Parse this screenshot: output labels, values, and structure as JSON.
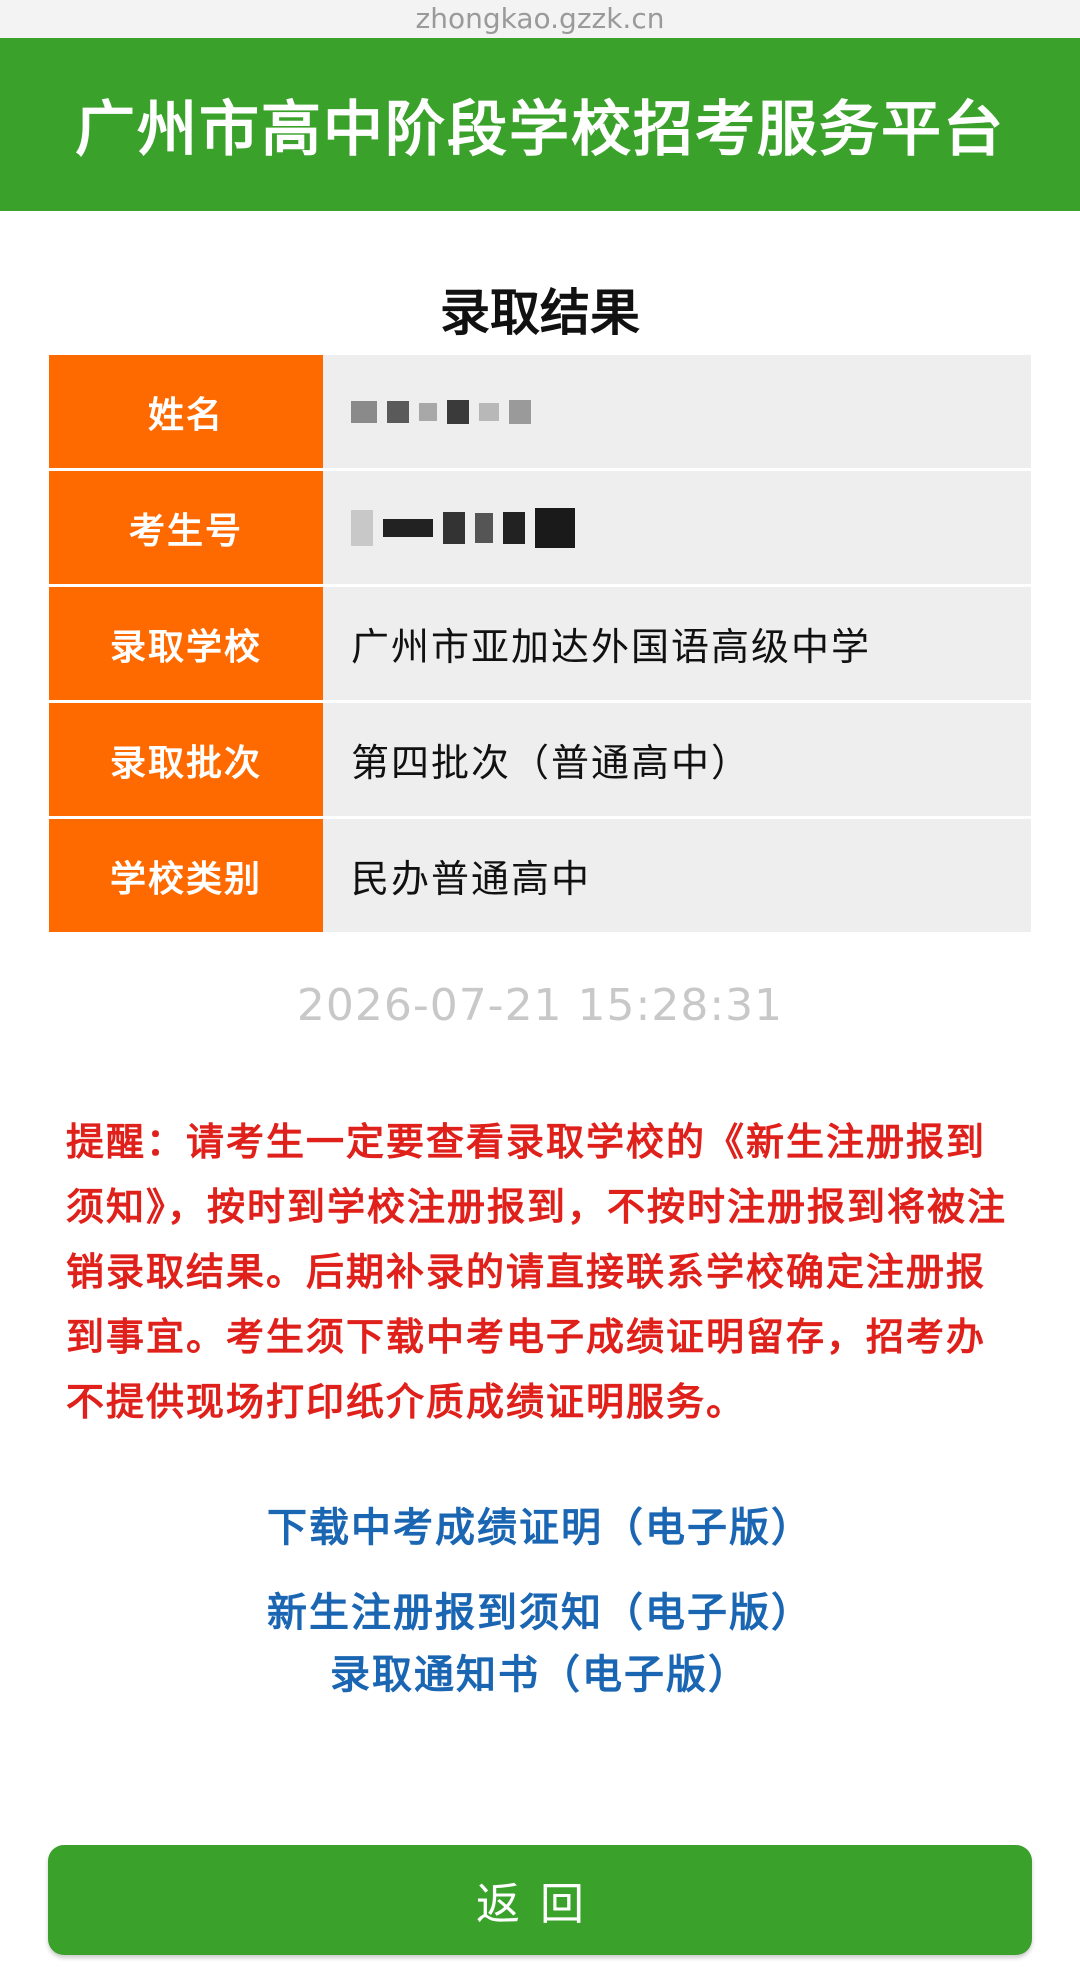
{
  "browser": {
    "url": "zhongkao.gzzk.cn"
  },
  "header": {
    "title": "广州市高中阶段学校招考服务平台"
  },
  "page": {
    "title": "录取结果"
  },
  "info_rows": [
    {
      "label": "姓名",
      "value": ""
    },
    {
      "label": "考生号",
      "value": ""
    },
    {
      "label": "录取学校",
      "value": "广州市亚加达外国语高级中学"
    },
    {
      "label": "录取批次",
      "value": "第四批次（普通高中）"
    },
    {
      "label": "学校类别",
      "value": "民办普通高中"
    }
  ],
  "timestamp": "2026-07-21 15:28:31",
  "reminder": "提醒：请考生一定要查看录取学校的《新生注册报到须知》，按时到学校注册报到，不按时注册报到将被注销录取结果。后期补录的请直接联系学校确定注册报到事宜。考生须下载中考电子成绩证明留存，招考办不提供现场打印纸介质成绩证明服务。",
  "links": [
    "下载中考成绩证明（电子版）",
    "新生注册报到须知（电子版）",
    "录取通知书（电子版）"
  ],
  "back_button": {
    "label": "返回"
  },
  "colors": {
    "header_green": "#3aa12b",
    "label_orange": "#ff6a00",
    "reminder_red": "#e0201b",
    "link_blue": "#1a66b3"
  }
}
